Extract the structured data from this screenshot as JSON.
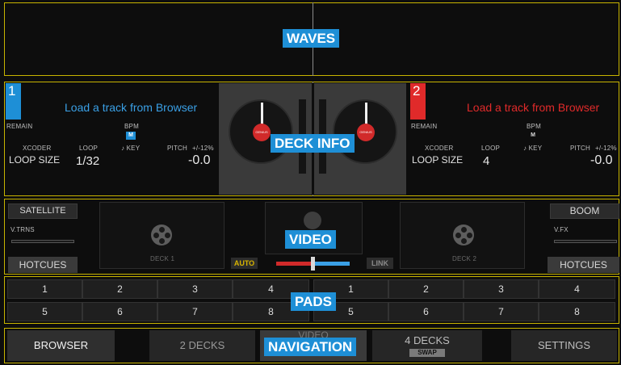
{
  "colors": {
    "frame": "#c8b400",
    "tag_bg": "#1e8fd6",
    "deck1_accent": "#1e8fd6",
    "deck2_accent": "#e02a2a",
    "link_blue": "#3aa0e6",
    "link_red": "#e02a2a",
    "auto": "#d8b400"
  },
  "labels": {
    "waves": "WAVES",
    "deck_info": "DECK INFO",
    "video": "VIDEO",
    "pads": "PADS",
    "navigation": "NAVIGATION"
  },
  "deck1": {
    "number": "1",
    "load_text": "Load a track from Browser",
    "remain": "REMAIN",
    "bpm": "BPM",
    "m_badge": "M",
    "xcoder": "XCODER",
    "loop": "LOOP",
    "key": "♪ KEY",
    "pitch": "PITCH",
    "pitch_range": "+/-12%",
    "loop_size": "LOOP SIZE",
    "loop_value": "1/32",
    "pitch_value": "-0.0"
  },
  "deck2": {
    "number": "2",
    "load_text": "Load a track from Browser",
    "remain": "REMAIN",
    "bpm": "BPM",
    "m_badge": "M",
    "xcoder": "XCODER",
    "loop": "LOOP",
    "key": "♪ KEY",
    "pitch": "PITCH",
    "pitch_range": "+/-12%",
    "loop_size": "LOOP SIZE",
    "loop_value": "4",
    "pitch_value": "-0.0"
  },
  "platter_label": "GENIUS",
  "video": {
    "left_top": "SATELLITE",
    "left_label": "V.TRNS",
    "left_hotcues": "HOTCUES",
    "right_top": "BOOM",
    "right_label": "V.FX",
    "right_hotcues": "HOTCUES",
    "deck1_label": "DECK 1",
    "deck2_label": "DECK 2",
    "auto": "AUTO",
    "link": "LINK"
  },
  "pads": {
    "left": [
      "1",
      "2",
      "3",
      "4",
      "5",
      "6",
      "7",
      "8"
    ],
    "right": [
      "1",
      "2",
      "3",
      "4",
      "5",
      "6",
      "7",
      "8"
    ]
  },
  "navigation": {
    "browser": "BROWSER",
    "two_decks": "2 DECKS",
    "video_partial": "VIDEO",
    "four_decks": "4 DECKS",
    "swap": "SWAP",
    "settings": "SETTINGS"
  }
}
